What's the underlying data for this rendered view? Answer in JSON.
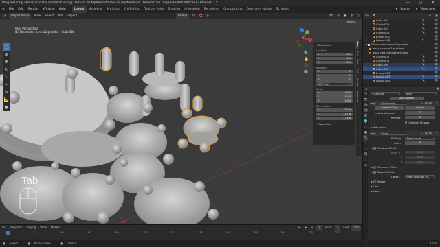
{
  "window": {
    "title": "Ring red ruby aleluarul 20:08 unde/Kill laudy) 02 Curs de bijutiri/Tutoriale de bijuterii/curs 03 Red ruby ring (aleluarul danced) - Blender 3.5"
  },
  "menu": {
    "items": [
      "File",
      "Edit",
      "Render",
      "Window",
      "Help"
    ],
    "workspaces": [
      "Layout",
      "Modeling",
      "Sculpting",
      "UV Editing",
      "Texture Paint",
      "Shading",
      "Animation",
      "Rendering",
      "Compositing",
      "Geometry Nodes",
      "Scripting"
    ],
    "active_workspace": "Layout",
    "scene": "Scene",
    "view_layer": "ViewLayer"
  },
  "viewport_header": {
    "mode": "Object Mode",
    "menus": [
      "View",
      "Select",
      "Add",
      "Object"
    ],
    "orientation": "Global",
    "options": "Options"
  },
  "viewport": {
    "info_line1": "User Perspective",
    "info_line2": "(1) Diamantes corona2 grandes | Cube.006",
    "key_overlay": "Tab",
    "gizmo_labels": [
      "X",
      "Y",
      "Z"
    ],
    "colors": {
      "background": "#3b3b3b",
      "grid": "#444444",
      "selection": "#e39a3b",
      "object": "#b9b9b9"
    }
  },
  "npanel": {
    "tabs": [
      "Item",
      "Tool",
      "View",
      "Edit",
      "3D Print",
      "Jewelcraft"
    ],
    "transform_title": "Transform",
    "location_label": "Location",
    "location": [
      [
        "X",
        "0 m"
      ],
      [
        "Y",
        "0 m"
      ],
      [
        "Z",
        "0 m"
      ]
    ],
    "rotation_label": "Rotation",
    "rotation": [
      [
        "X",
        "0°"
      ],
      [
        "Y",
        "0°"
      ],
      [
        "Z",
        "0°"
      ]
    ],
    "rotation_mode": "XYZ Euler",
    "scale_label": "Scale",
    "scale": [
      [
        "X",
        "1.000"
      ],
      [
        "Y",
        "1.000"
      ],
      [
        "Z",
        "1.000"
      ]
    ],
    "dimensions_label": "Dimensions",
    "dimensions": [
      [
        "X",
        "13.7 m"
      ],
      [
        "Y",
        "13.7 m"
      ],
      [
        "Z",
        "1.24 m"
      ]
    ],
    "properties_title": "Properties"
  },
  "timeline": {
    "menus": [
      "Playback",
      "Keying",
      "View",
      "Marker"
    ],
    "frame_numbers": [
      "0",
      "20",
      "40",
      "60",
      "80",
      "100",
      "120",
      "140",
      "160",
      "180",
      "200",
      "220",
      "240"
    ],
    "current_frame": "1",
    "start_label": "Start",
    "start": "1",
    "end_label": "End",
    "end": "250"
  },
  "statusbar": {
    "items": [
      "Select",
      "Rotate View",
      "Object"
    ],
    "version": "3.5.0"
  },
  "outliner": {
    "items": [
      {
        "label": "Cube.002",
        "state": ""
      },
      {
        "label": "Circle.003",
        "state": ""
      },
      {
        "label": "Cube.003",
        "state": ""
      },
      {
        "label": "Circle.004",
        "state": ""
      },
      {
        "label": "Empty.002",
        "state": ""
      },
      {
        "label": "Round.002",
        "state": ""
      },
      {
        "label": "Diamantes corona2 grandes",
        "state": ""
      },
      {
        "label": "array coronas2 principal",
        "state": ""
      },
      {
        "label": "array una corona2 grandes",
        "state": ""
      },
      {
        "label": "Circle.005",
        "state": ""
      },
      {
        "label": "Circle.006",
        "state": ""
      },
      {
        "label": "Cube.005",
        "state": "hl"
      },
      {
        "label": "Cube.006",
        "state": "sel"
      },
      {
        "label": "Empty.003",
        "state": ""
      },
      {
        "label": "Round.003",
        "state": ""
      },
      {
        "label": "Round.004",
        "state": ""
      }
    ]
  },
  "properties": {
    "object_name": "Cube.006",
    "modifier_tab": "Array",
    "add_modifier": "Add Modifier",
    "subdiv": {
      "name": "Subdivision",
      "catmull": "Catmull-Clark",
      "simple": "Simple",
      "levels_label": "Levels Viewport",
      "levels": "2",
      "render_label": "Render",
      "render": "2",
      "optimal": "Optimal Display",
      "advanced": "Advanced"
    },
    "array": {
      "name": "Array",
      "fit_type_label": "Fit Type",
      "fit_type": "Fixed Count",
      "count_label": "Count",
      "count": "8",
      "relative_offset": "Relative Offset",
      "factor_x_label": "Factor X",
      "factor_x": "1.000",
      "factor_y_label": "Y",
      "factor_y": "0.000",
      "factor_z_label": "Z",
      "factor_z": "0.000",
      "constant_offset": "Constant Offset",
      "object_offset": "Object Offset",
      "object_label": "Object",
      "object_value": "array coronas2 pr...",
      "merge": "Merge",
      "uvs": "UVs",
      "caps": "Caps"
    }
  }
}
